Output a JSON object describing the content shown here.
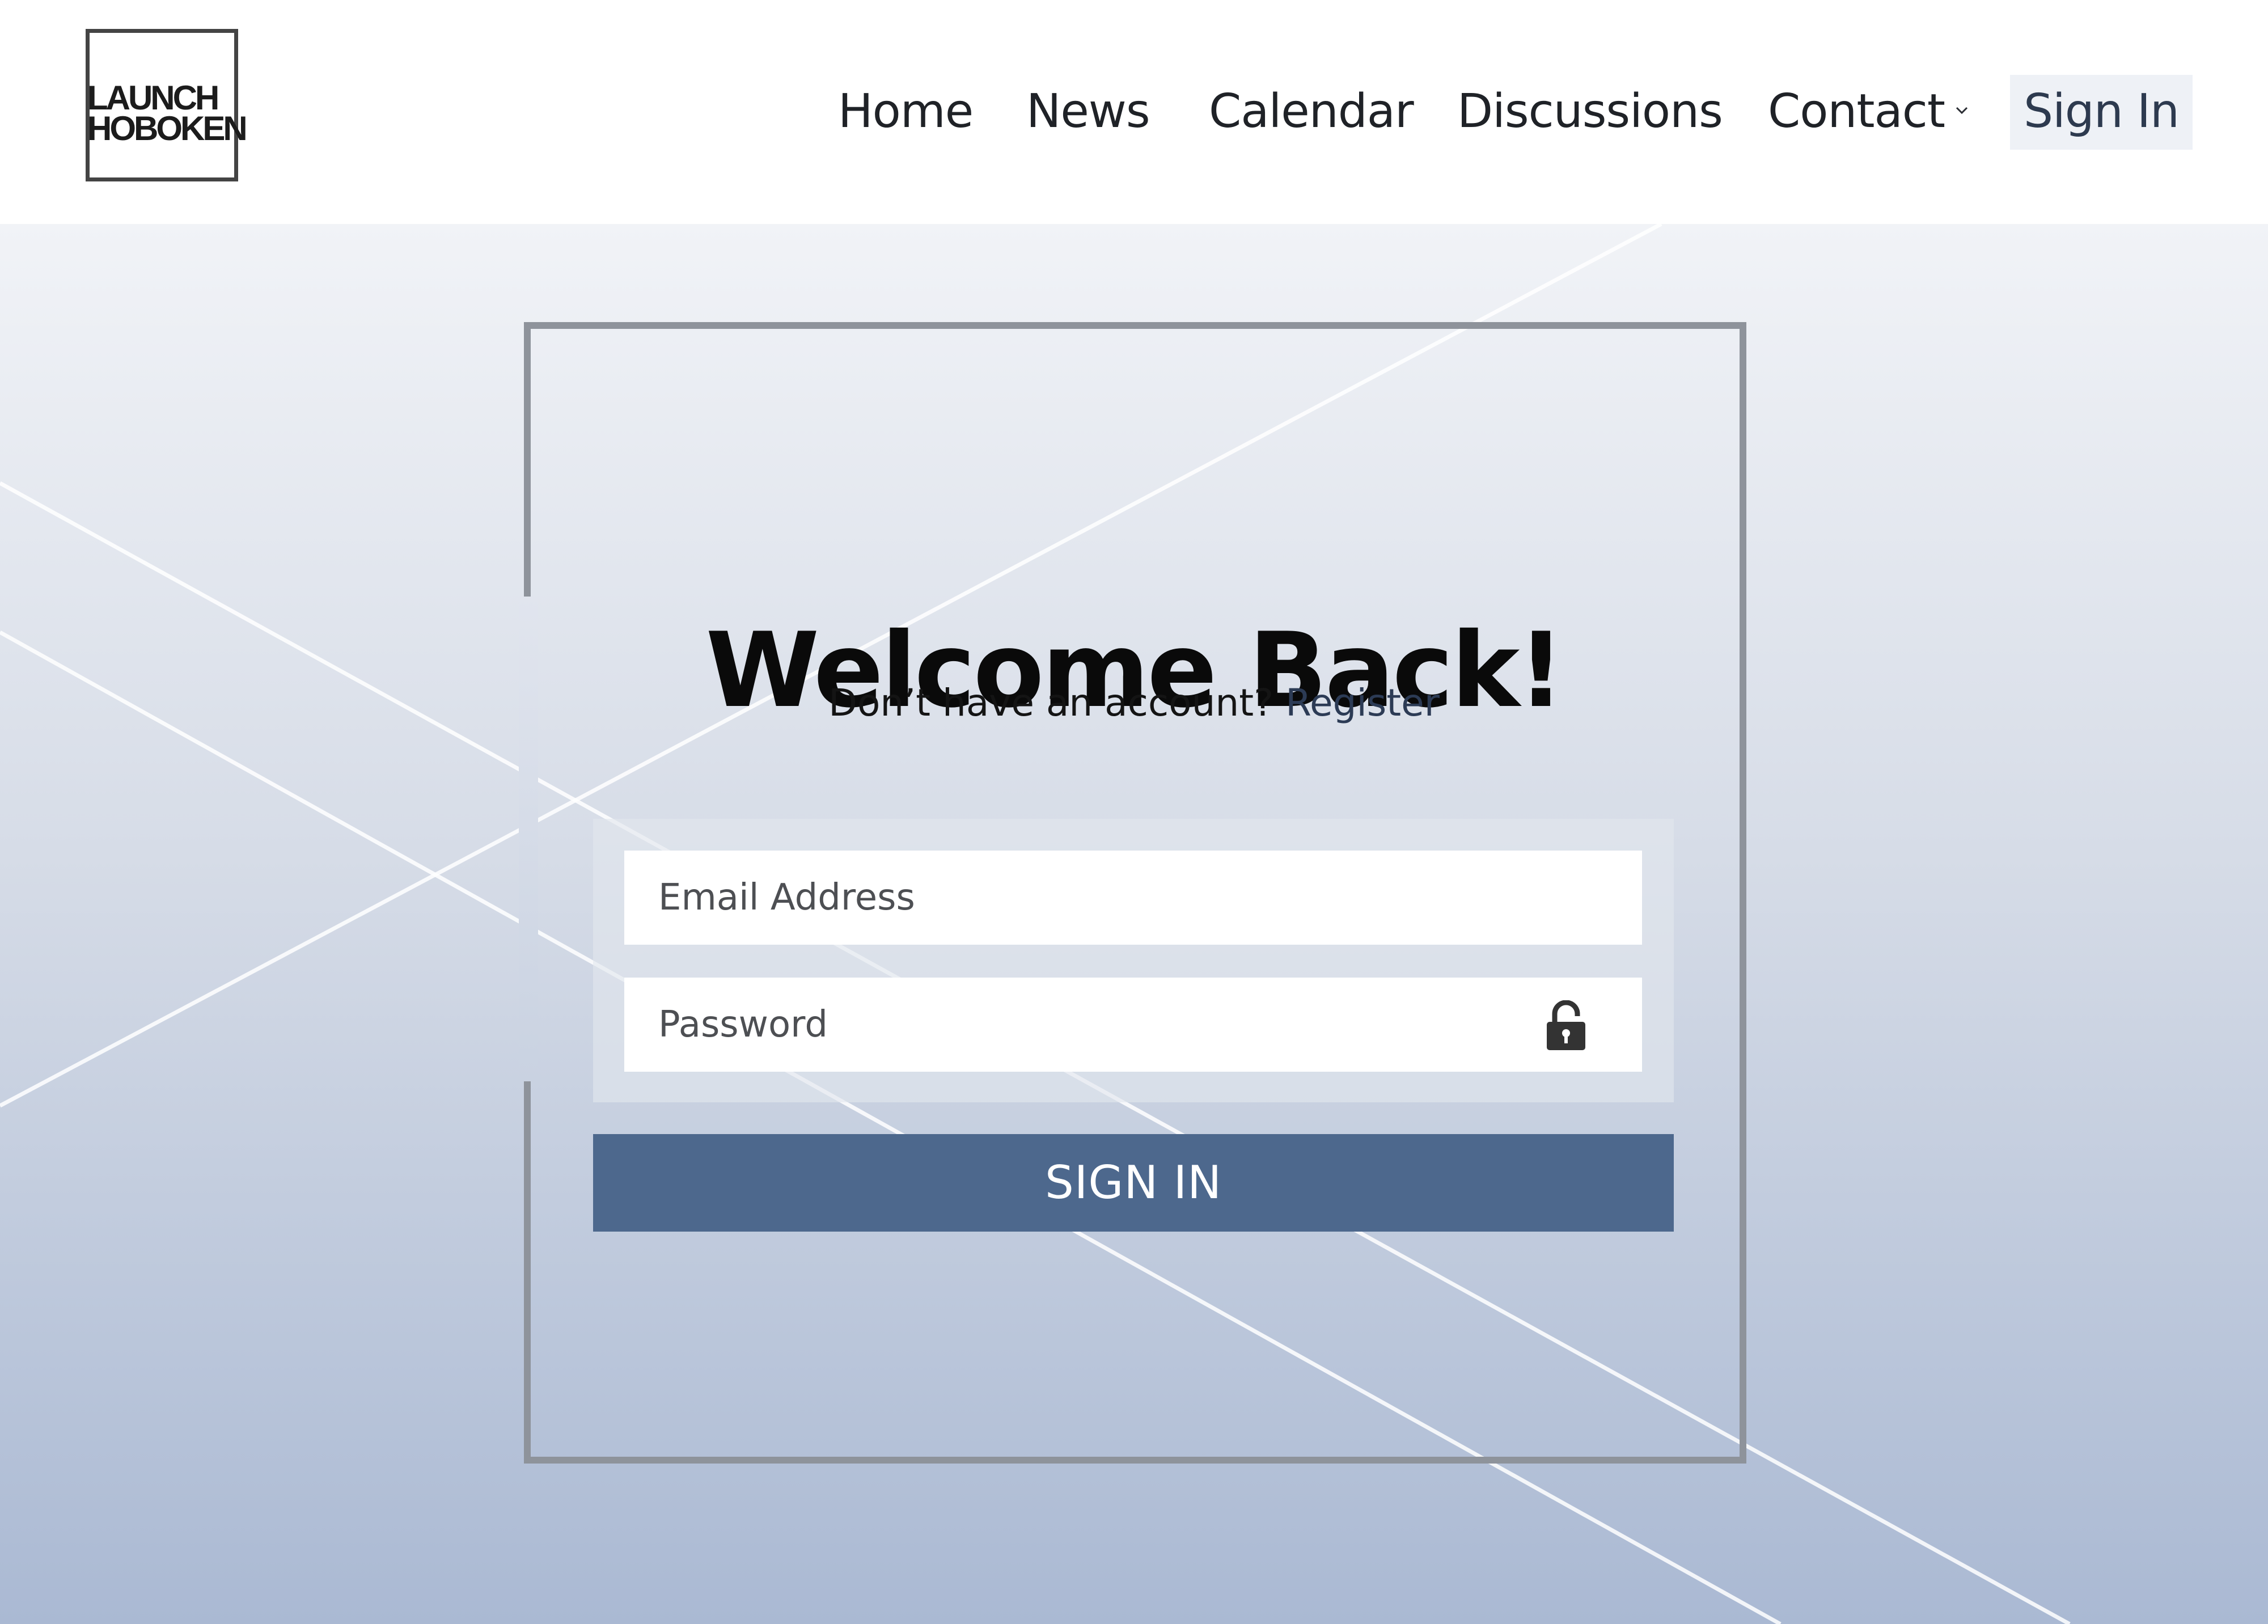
{
  "header": {
    "logo": {
      "line1": "LAUNCH",
      "line2": "HOBOKEN"
    },
    "nav": [
      {
        "label": "Home"
      },
      {
        "label": "News"
      },
      {
        "label": "Calendar"
      },
      {
        "label": "Discussions"
      },
      {
        "label": "Contact",
        "has_dropdown": true
      }
    ],
    "sign_in_label": "Sign In"
  },
  "login": {
    "title": "Welcome Back!",
    "prompt": "Don’t have an account?",
    "register_label": "Register",
    "email_placeholder": "Email Address",
    "password_placeholder": "Password",
    "submit_label": "SIGN IN"
  },
  "icons": {
    "dropdown": "chevron-down-icon",
    "password": "lock-icon"
  },
  "colors": {
    "button": "#4d688d",
    "frame": "#8e939b",
    "gradient_top": "#f1f3f7",
    "gradient_bottom": "#aab9d3"
  }
}
